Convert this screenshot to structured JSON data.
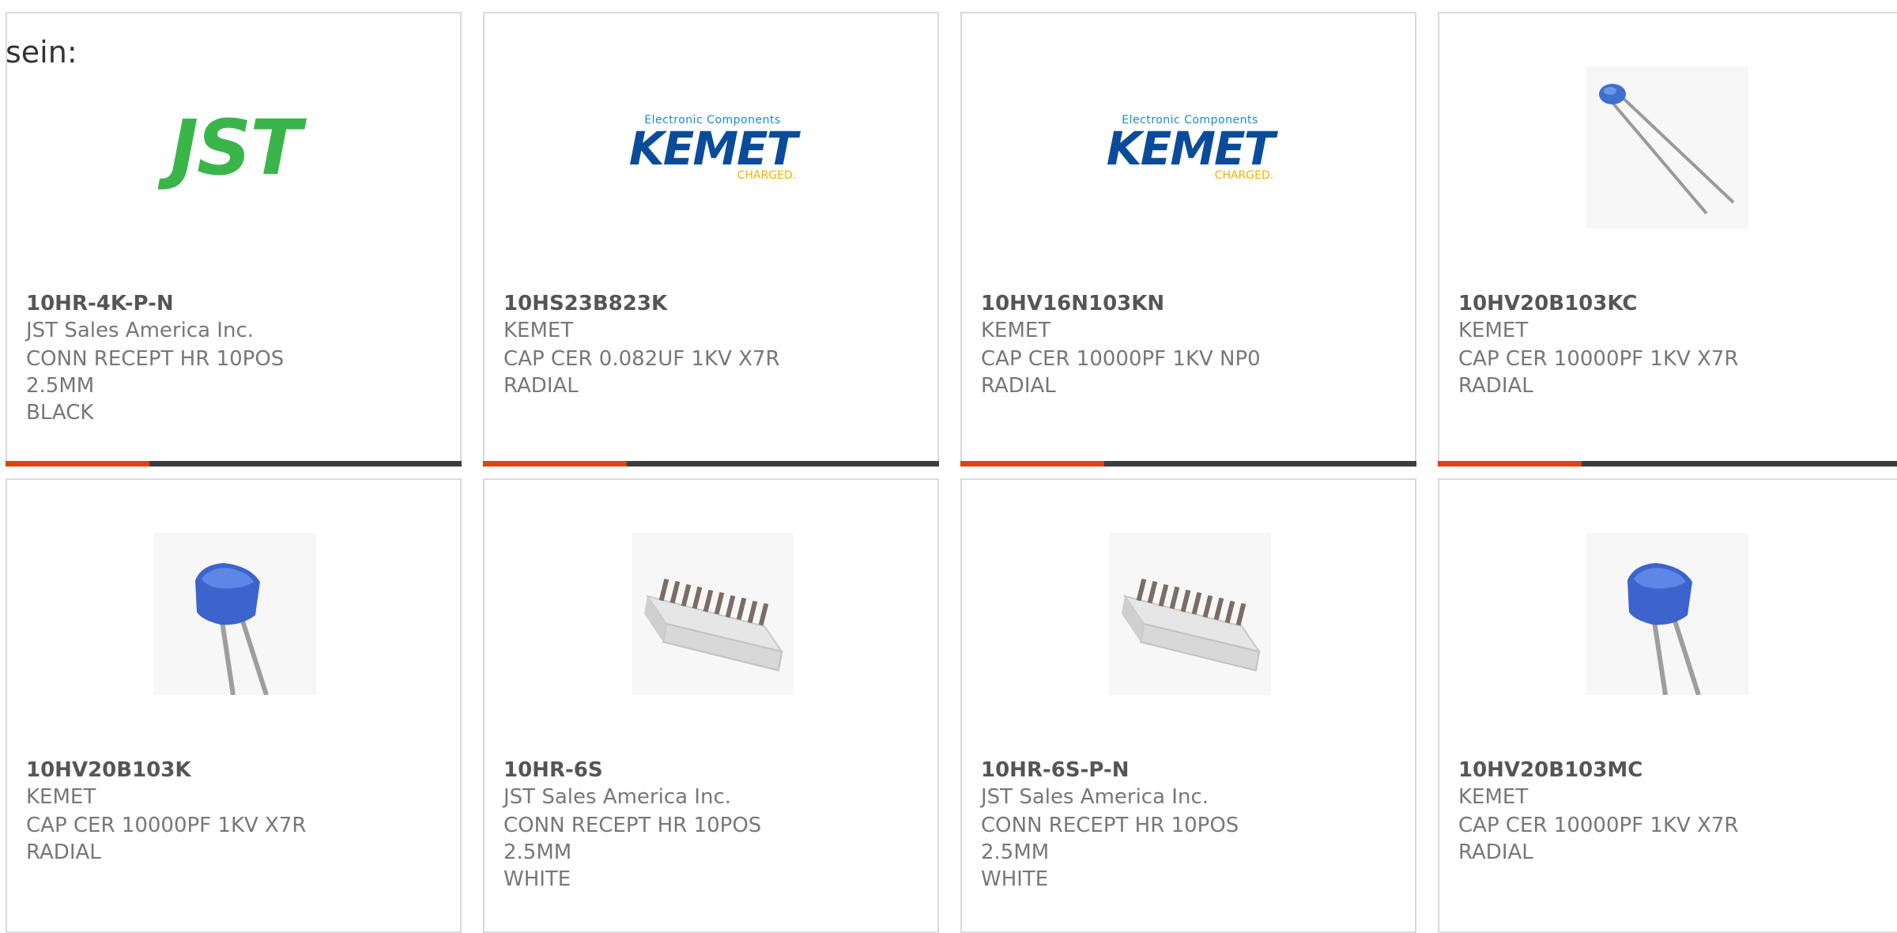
{
  "lead_text": "sein:",
  "colors": {
    "accent": "#e0440e",
    "bar": "#3d3d3d",
    "border": "#dadada",
    "jst_green": "#3ab54a",
    "kemet_blue": "#0a4c9a",
    "kemet_gold": "#f2b200"
  },
  "brand_logos": {
    "jst": "JST",
    "kemet_top": "Electronic Components",
    "kemet_main": "KEMET",
    "kemet_sub": "CHARGED."
  },
  "products": [
    {
      "part": "10HR-4K-P-N",
      "manufacturer": "JST Sales America Inc.",
      "desc1": "CONN RECEPT HR 10POS 2.5MM",
      "desc2": "BLACK",
      "image": "jst-logo"
    },
    {
      "part": "10HS23B823K",
      "manufacturer": "KEMET",
      "desc1": "CAP CER 0.082UF 1KV X7R",
      "desc2": "RADIAL",
      "image": "kemet-logo"
    },
    {
      "part": "10HV16N103KN",
      "manufacturer": "KEMET",
      "desc1": "CAP CER 10000PF 1KV NP0",
      "desc2": "RADIAL",
      "image": "kemet-logo"
    },
    {
      "part": "10HV20B103KC",
      "manufacturer": "KEMET",
      "desc1": "CAP CER 10000PF 1KV X7R",
      "desc2": "RADIAL",
      "image": "capacitor-small-photo"
    },
    {
      "part": "10HV20B103K",
      "manufacturer": "KEMET",
      "desc1": "CAP CER 10000PF 1KV X7R",
      "desc2": "RADIAL",
      "image": "capacitor-photo"
    },
    {
      "part": "10HR-6S",
      "manufacturer": "JST Sales America Inc.",
      "desc1": "CONN RECEPT HR 10POS 2.5MM",
      "desc2": "WHITE",
      "image": "connector-photo"
    },
    {
      "part": "10HR-6S-P-N",
      "manufacturer": "JST Sales America Inc.",
      "desc1": "CONN RECEPT HR 10POS 2.5MM",
      "desc2": "WHITE",
      "image": "connector-photo"
    },
    {
      "part": "10HV20B103MC",
      "manufacturer": "KEMET",
      "desc1": "CAP CER 10000PF 1KV X7R",
      "desc2": "RADIAL",
      "image": "capacitor-photo"
    }
  ]
}
